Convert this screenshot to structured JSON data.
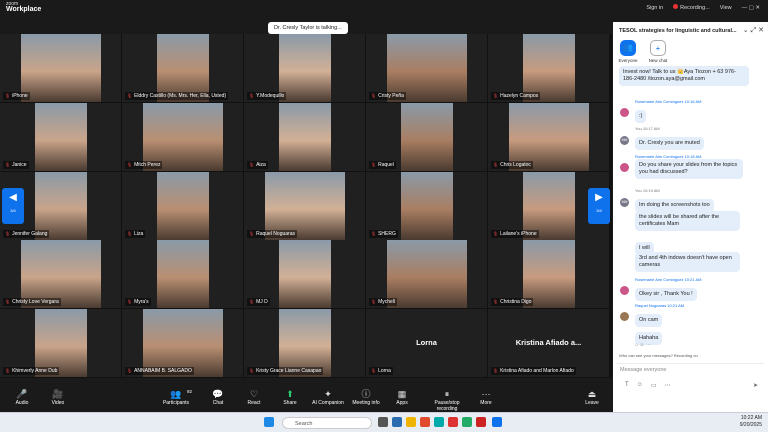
{
  "app": {
    "logo_top": "zoom",
    "logo_bottom": "Workplace",
    "sign_in": "Sign in",
    "recording": "Recording...",
    "view": "View"
  },
  "talking": "Dr. Cresly Taylor is talking...",
  "page_indicator": {
    "left": "3/4",
    "right": "3/4"
  },
  "tiles": [
    {
      "name": "iPhone"
    },
    {
      "name": "Elddry Castillo (Ms. Mrs. Her, Ella, Usted)"
    },
    {
      "name": "Y.Modequillo"
    },
    {
      "name": "Cristy Peña"
    },
    {
      "name": "Hazelyn Campos"
    },
    {
      "name": "Janice"
    },
    {
      "name": "Mitch Perez"
    },
    {
      "name": "Aiza"
    },
    {
      "name": "Raquel"
    },
    {
      "name": "Chris Logatoc"
    },
    {
      "name": "Jennifer Galang"
    },
    {
      "name": "Liza"
    },
    {
      "name": "Raquel Noguaras"
    },
    {
      "name": "SHERG"
    },
    {
      "name": "Lailane's iPhone"
    },
    {
      "name": "Christy Love Vergara"
    },
    {
      "name": "Myra's"
    },
    {
      "name": "MJ D"
    },
    {
      "name": "Mychell"
    },
    {
      "name": "Christina Digo"
    },
    {
      "name": "Khimverly Anne Dub"
    },
    {
      "name": "ANNABAIM B. SALGADO"
    },
    {
      "name": "Kristy Grace Lianne Casapao"
    },
    {
      "name": "Lorna",
      "big": "Lorna"
    },
    {
      "name": "Kristina Afiado and Marlon Afiado",
      "big": "Kristina Afiado a..."
    }
  ],
  "toolbar": [
    {
      "label": "Audio",
      "icon": "🎤"
    },
    {
      "label": "Video",
      "icon": "🎥"
    },
    {
      "label": "Participants",
      "icon": "👥",
      "count": "92"
    },
    {
      "label": "Chat",
      "icon": "💬"
    },
    {
      "label": "React",
      "icon": "♡"
    },
    {
      "label": "Share",
      "icon": "⬆"
    },
    {
      "label": "AI Companion",
      "icon": "✦"
    },
    {
      "label": "Meeting info",
      "icon": "ⓘ"
    },
    {
      "label": "Apps",
      "icon": "▦"
    },
    {
      "label": "Pause/stop recording",
      "icon": "⏸"
    },
    {
      "label": "More",
      "icon": "⋯"
    },
    {
      "label": "Leave",
      "icon": "⏏"
    }
  ],
  "chat": {
    "title": "TESOL strategies for linguistic and cultural...",
    "tab_everyone": "Everyone",
    "tab_new_chat": "New chat",
    "m0": "Invest now! Talk to us 👑Aya Tiozon + 63 976-186-2480 /tiozon.aya@gmail.com",
    "m1_meta": "Rosemarie Aim Cominguez  10:16 AM",
    "m1": ":)",
    "m2_meta": "You  10:17 AM",
    "m2": "Dr. Cresly you are muted",
    "m3_meta": "Rosemarie Aim Cominguez  10:18 AM",
    "m3": "Do you share your slides from the topics you had discussed?",
    "m4_meta": "You  10:19 AM",
    "m4": "Im doing the screenshots too",
    "m5": "the slides will be shared after the certificates Mam",
    "m6": "I will",
    "m7": "3rd and 4th indows doesn't have open cameras",
    "m8_meta": "Rosemarie Aim Cominguez  10:21 AM",
    "m8": "Okey sir , Thank You !",
    "m9_meta": "Raquel Noguaras  10:21 AM",
    "m9": "On cam",
    "m10": "Hahaha",
    "notice": "Who can see your messages? Recording on",
    "placeholder": "Message everyone"
  },
  "taskbar": {
    "search": "Search",
    "time": "10:22 AM",
    "date": "9/20/2025"
  },
  "colors": {
    "accent": "#0e72ed",
    "background": "#1a1a1a"
  }
}
